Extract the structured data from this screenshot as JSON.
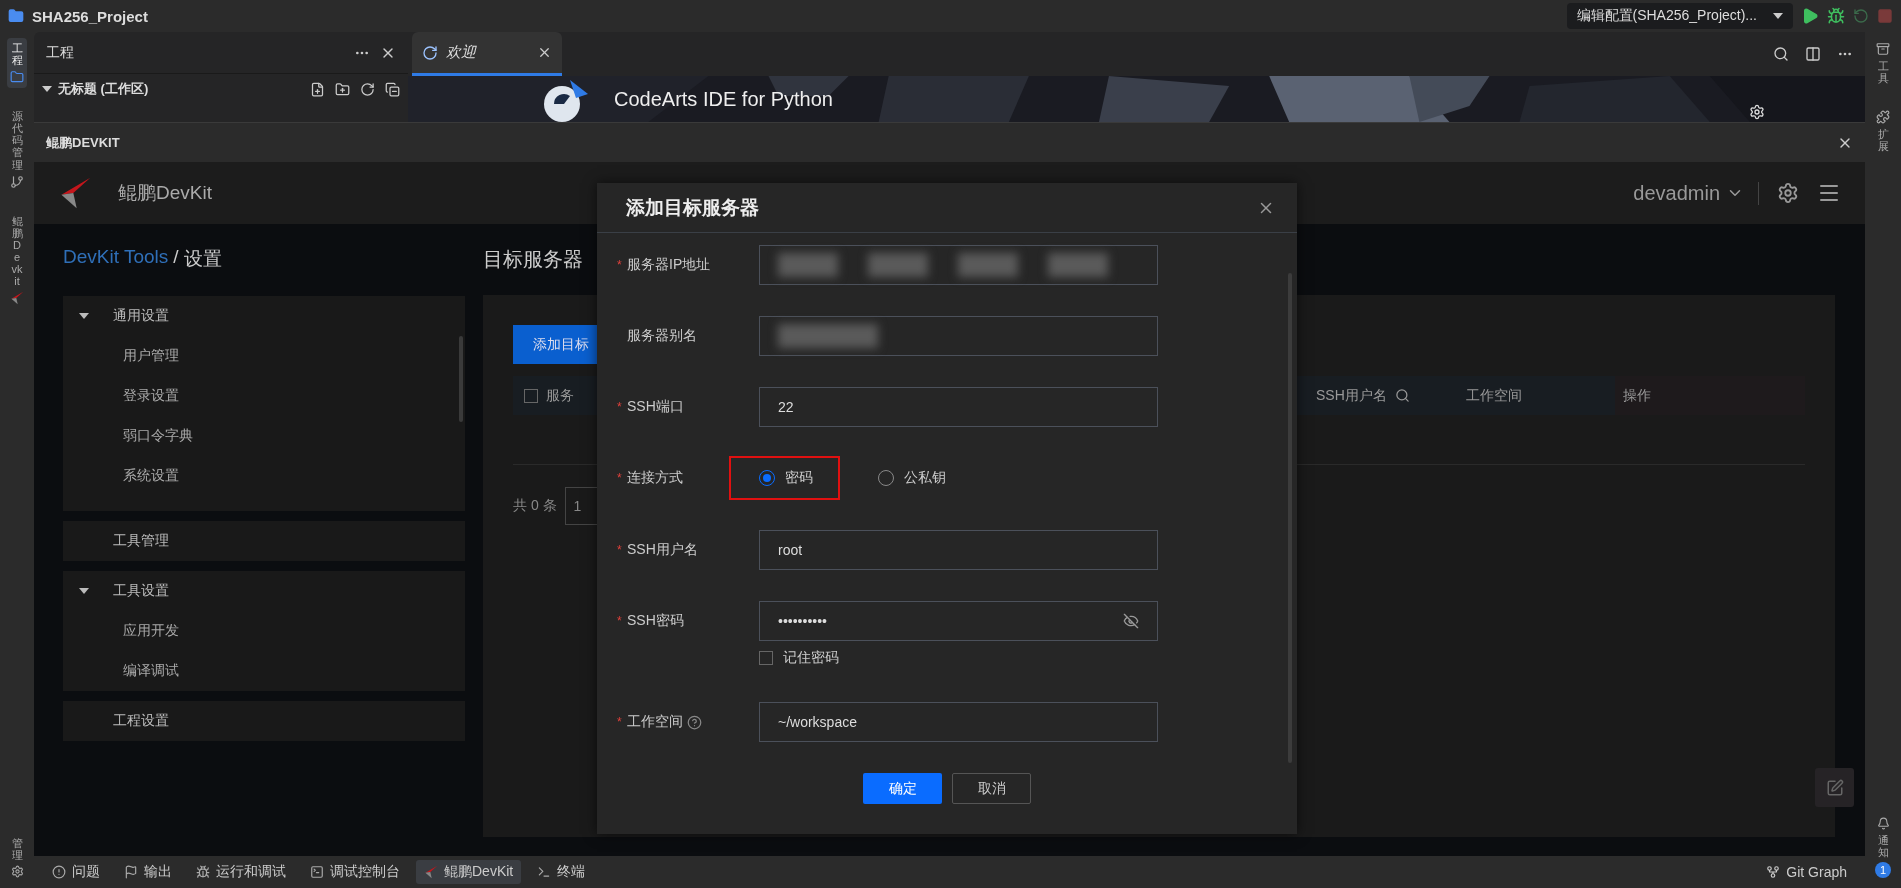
{
  "title_bar": {
    "project": "SHA256_Project",
    "run_config": "编辑配置(SHA256_Project)..."
  },
  "left_activity": [
    {
      "label": "工程",
      "selected": true
    },
    {
      "label": "源代码管理",
      "selected": false
    },
    {
      "label": "鲲鹏Devkit",
      "selected": false
    }
  ],
  "left_activity_bottom": {
    "label": "管理"
  },
  "right_activity": [
    {
      "label": "工具"
    },
    {
      "label": "扩展"
    }
  ],
  "right_activity_bottom": {
    "label": "通知",
    "badge": "1"
  },
  "explorer": {
    "title": "工程",
    "workspace": "无标题 (工作区)",
    "expanded": true
  },
  "editor": {
    "tabs": [
      {
        "label": "欢迎",
        "selected": true
      }
    ],
    "welcome_title": "CodeArts IDE for Python"
  },
  "panel": {
    "title": "鲲鹏DEVKIT"
  },
  "devkit": {
    "brand": "鲲鹏DevKit",
    "user": "devadmin",
    "breadcrumb": {
      "link": "DevKit Tools",
      "separator": "/",
      "current": "设置"
    },
    "menu": [
      {
        "label": "通用设置",
        "expanded": true,
        "children": [
          {
            "label": "用户管理"
          },
          {
            "label": "登录设置"
          },
          {
            "label": "弱口令字典"
          },
          {
            "label": "系统设置"
          }
        ]
      },
      {
        "label": "工具管理"
      },
      {
        "label": "工具设置",
        "expanded": true,
        "children": [
          {
            "label": "应用开发"
          },
          {
            "label": "编译调试"
          }
        ]
      },
      {
        "label": "工程设置"
      }
    ],
    "page_title": "目标服务器",
    "add_button": "添加目标",
    "select_all": {
      "checked": false
    },
    "columns": [
      {
        "label": "服务",
        "searchable": false
      },
      {
        "label": "SSH用户名",
        "searchable": true
      },
      {
        "label": "工作空间",
        "searchable": false
      },
      {
        "label": "操作",
        "searchable": false
      }
    ],
    "total": "共 0 条",
    "page": "1"
  },
  "dialog": {
    "title": "添加目标服务器",
    "fields": [
      {
        "kind": "text",
        "label": "服务器IP地址",
        "required_mark": "*",
        "redacted": true
      },
      {
        "kind": "text",
        "label": "服务器别名",
        "redacted": true
      },
      {
        "kind": "text",
        "label": "SSH端口",
        "required_mark": "*",
        "value": "22"
      },
      {
        "kind": "radio",
        "label": "连接方式",
        "required_mark": "*",
        "options": [
          {
            "label": "密码",
            "selected": true,
            "highlighted": true
          },
          {
            "label": "公私钥",
            "selected": false,
            "highlighted": false
          }
        ]
      },
      {
        "kind": "text",
        "label": "SSH用户名",
        "required_mark": "*",
        "value": "root"
      },
      {
        "kind": "password",
        "label": "SSH密码",
        "required_mark": "*",
        "value": "••••••••••",
        "remember": {
          "label": "记住密码",
          "checked": false
        }
      },
      {
        "kind": "text",
        "label": "工作空间",
        "required_mark": "*",
        "help": true,
        "value": "~/workspace"
      }
    ],
    "confirm": "确定",
    "cancel": "取消"
  },
  "status_bar": {
    "items": [
      {
        "label": "问题",
        "selected": false
      },
      {
        "label": "输出",
        "selected": false
      },
      {
        "label": "运行和调试",
        "selected": false
      },
      {
        "label": "调试控制台",
        "selected": false
      },
      {
        "label": "鲲鹏DevKit",
        "selected": true
      },
      {
        "label": "终端",
        "selected": false
      }
    ],
    "git": "Git Graph"
  }
}
